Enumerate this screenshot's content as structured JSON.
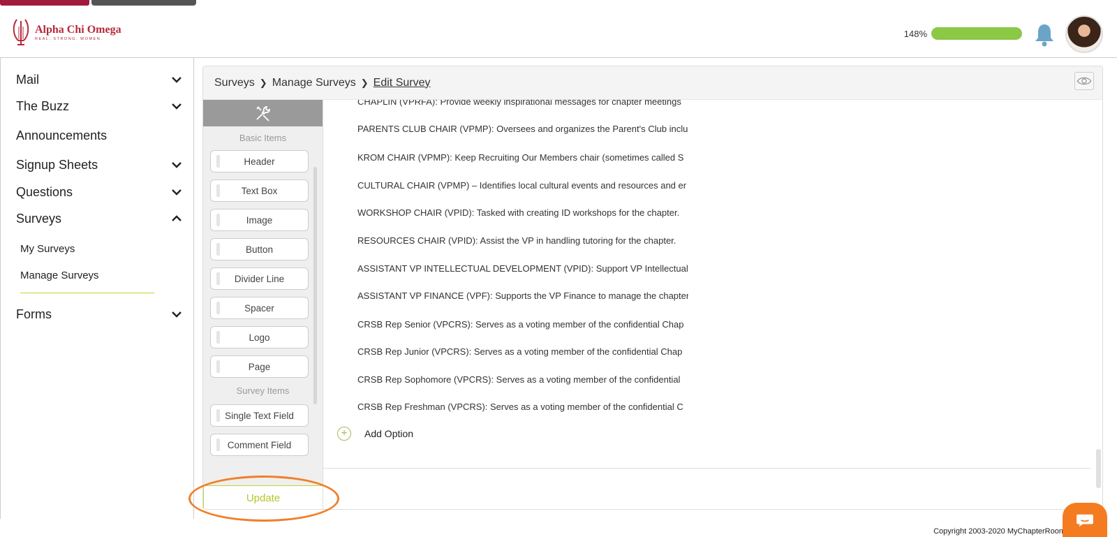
{
  "brand": {
    "name": "Alpha Chi Omega",
    "tagline": "REAL. STRONG. WOMEN.",
    "color": "#b52a3a"
  },
  "header": {
    "progress_label": "148%",
    "progress_value": 1.0,
    "progress_color": "#8ac846",
    "bell_icon": "bell-icon",
    "avatar_icon": "user-avatar"
  },
  "sidebar": {
    "items": [
      {
        "label": "Mail",
        "chevron": "down"
      },
      {
        "label": "The Buzz",
        "chevron": "down"
      },
      {
        "label": "Announcements",
        "chevron": null
      },
      {
        "label": "Signup Sheets",
        "chevron": "down"
      },
      {
        "label": "Questions",
        "chevron": "down"
      },
      {
        "label": "Surveys",
        "chevron": "up"
      },
      {
        "label": "Forms",
        "chevron": "down"
      }
    ],
    "sub_items": [
      "My Surveys",
      "Manage Surveys"
    ],
    "active_sub": "Manage Surveys",
    "accent": "#c2d330"
  },
  "breadcrumb": {
    "items": [
      "Surveys",
      "Manage Surveys",
      "Edit Survey"
    ],
    "separator": ">"
  },
  "palette": {
    "tools_icon": "tools-icon",
    "basic_label": "Basic Items",
    "basic_items": [
      "Header",
      "Text Box",
      "Image",
      "Button",
      "Divider Line",
      "Spacer",
      "Logo",
      "Page"
    ],
    "survey_label": "Survey Items",
    "survey_items": [
      "Single Text Field",
      "Comment Field"
    ],
    "update_label": "Update"
  },
  "options": [
    "CHAPLIN (VPRFA): Provide weekly inspirational messages for chapter meetings",
    "PARENTS CLUB CHAIR (VPMP): Oversees and organizes the Parent's Club incluc",
    "KROM CHAIR (VPMP): Keep Recruiting Our Members chair (sometimes called S",
    "CULTURAL CHAIR (VPMP) – Identifies local cultural events and resources and er",
    "WORKSHOP CHAIR (VPID): Tasked with creating ID workshops for the chapter.",
    "RESOURCES CHAIR (VPID): Assist the VP in handling tutoring for the chapter.",
    "ASSISTANT VP INTELLECTUAL DEVELOPMENT (VPID): Support VP Intellectual Deve",
    "ASSISTANT VP FINANCE (VPF): Supports the VP Finance to manage the chapter",
    "CRSB Rep Senior (VPCRS): Serves as a voting member of the confidential Chap",
    "CRSB Rep Junior (VPCRS): Serves as a voting member of the confidential Chap",
    "CRSB Rep Sophomore (VPCRS): Serves as a voting member of the confidential",
    "CRSB Rep Freshman (VPCRS): Serves as a voting member of the confidential C"
  ],
  "add_option_label": "Add Option",
  "footer": {
    "copyright": "Copyright 2003-2020 MyChapterRoom"
  },
  "chat_icon": "chat-icon",
  "chat_color": "#f47b20"
}
